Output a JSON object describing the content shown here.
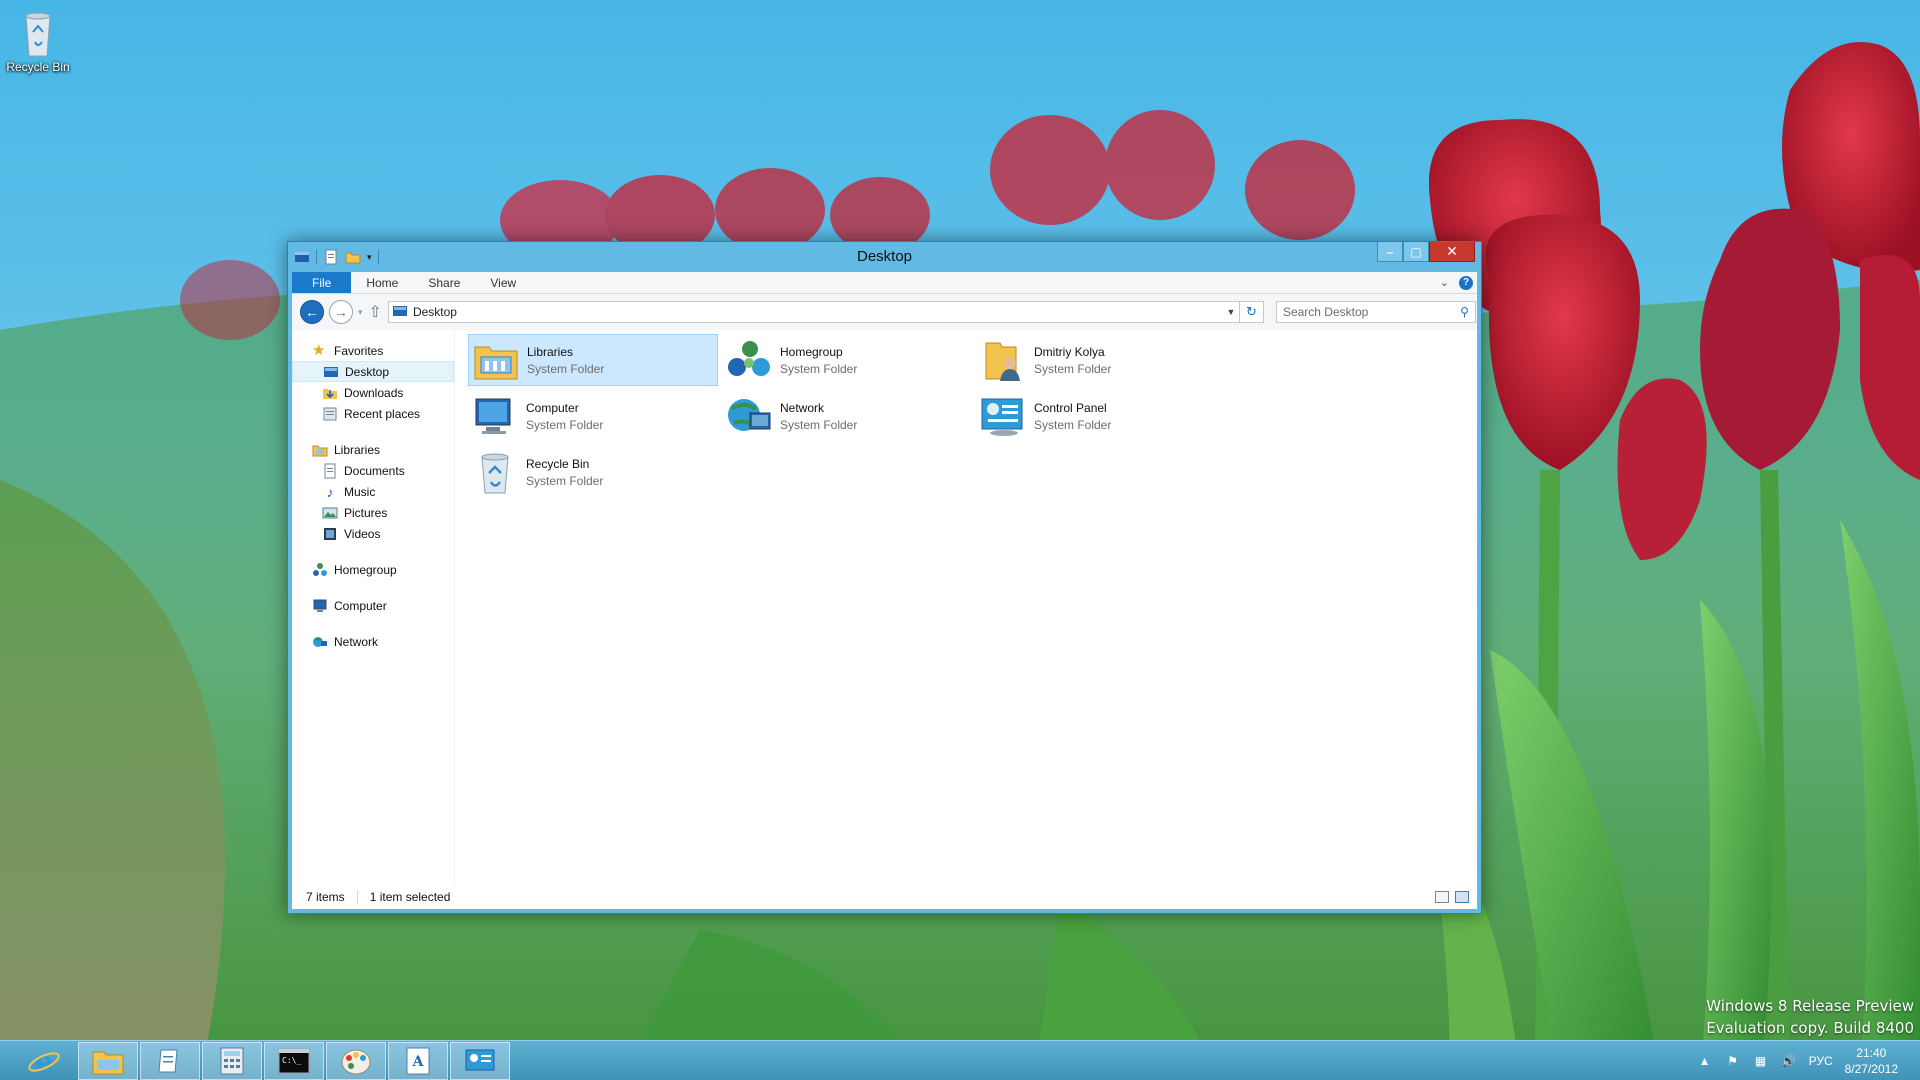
{
  "desktop": {
    "icons": [
      {
        "label": "Recycle Bin",
        "icon": "recycle-bin-icon"
      }
    ]
  },
  "window": {
    "title": "Desktop",
    "ribbon_tabs": [
      "File",
      "Home",
      "Share",
      "View"
    ],
    "nav": {
      "back_icon": "back-arrow-icon",
      "forward_icon": "forward-arrow-icon",
      "address_path": "Desktop",
      "search_placeholder": "Search Desktop"
    },
    "nav_pane": {
      "favorites": {
        "label": "Favorites",
        "items": [
          "Desktop",
          "Downloads",
          "Recent places"
        ],
        "selected": "Desktop"
      },
      "libraries": {
        "label": "Libraries",
        "items": [
          "Documents",
          "Music",
          "Pictures",
          "Videos"
        ]
      },
      "homegroup": "Homegroup",
      "computer": "Computer",
      "network": "Network"
    },
    "items": [
      {
        "name": "Libraries",
        "type": "System Folder",
        "icon": "libraries-folder-icon",
        "selected": true
      },
      {
        "name": "Homegroup",
        "type": "System Folder",
        "icon": "homegroup-icon"
      },
      {
        "name": "Dmitriy Kolya",
        "type": "System Folder",
        "icon": "user-folder-icon"
      },
      {
        "name": "Computer",
        "type": "System Folder",
        "icon": "computer-icon"
      },
      {
        "name": "Network",
        "type": "System Folder",
        "icon": "network-icon"
      },
      {
        "name": "Control Panel",
        "type": "System Folder",
        "icon": "control-panel-icon"
      },
      {
        "name": "Recycle Bin",
        "type": "System Folder",
        "icon": "recycle-bin-icon"
      }
    ],
    "status": {
      "count": "7 items",
      "selection": "1 item selected"
    }
  },
  "watermark": {
    "line1": "Windows 8 Release Preview",
    "line2": "Evaluation copy. Build 8400"
  },
  "taskbar": {
    "apps": [
      "internet-explorer-icon",
      "file-explorer-icon",
      "notepad-icon",
      "calculator-icon",
      "command-prompt-icon",
      "paint-icon",
      "wordpad-icon",
      "control-panel-icon"
    ],
    "tray": {
      "language": "РУС",
      "time": "21:40",
      "date": "8/27/2012"
    }
  },
  "colors": {
    "accent": "#1979ca",
    "window_frame": "#62b9e4",
    "close_button": "#c7392c",
    "selection": "#cce8ff"
  }
}
